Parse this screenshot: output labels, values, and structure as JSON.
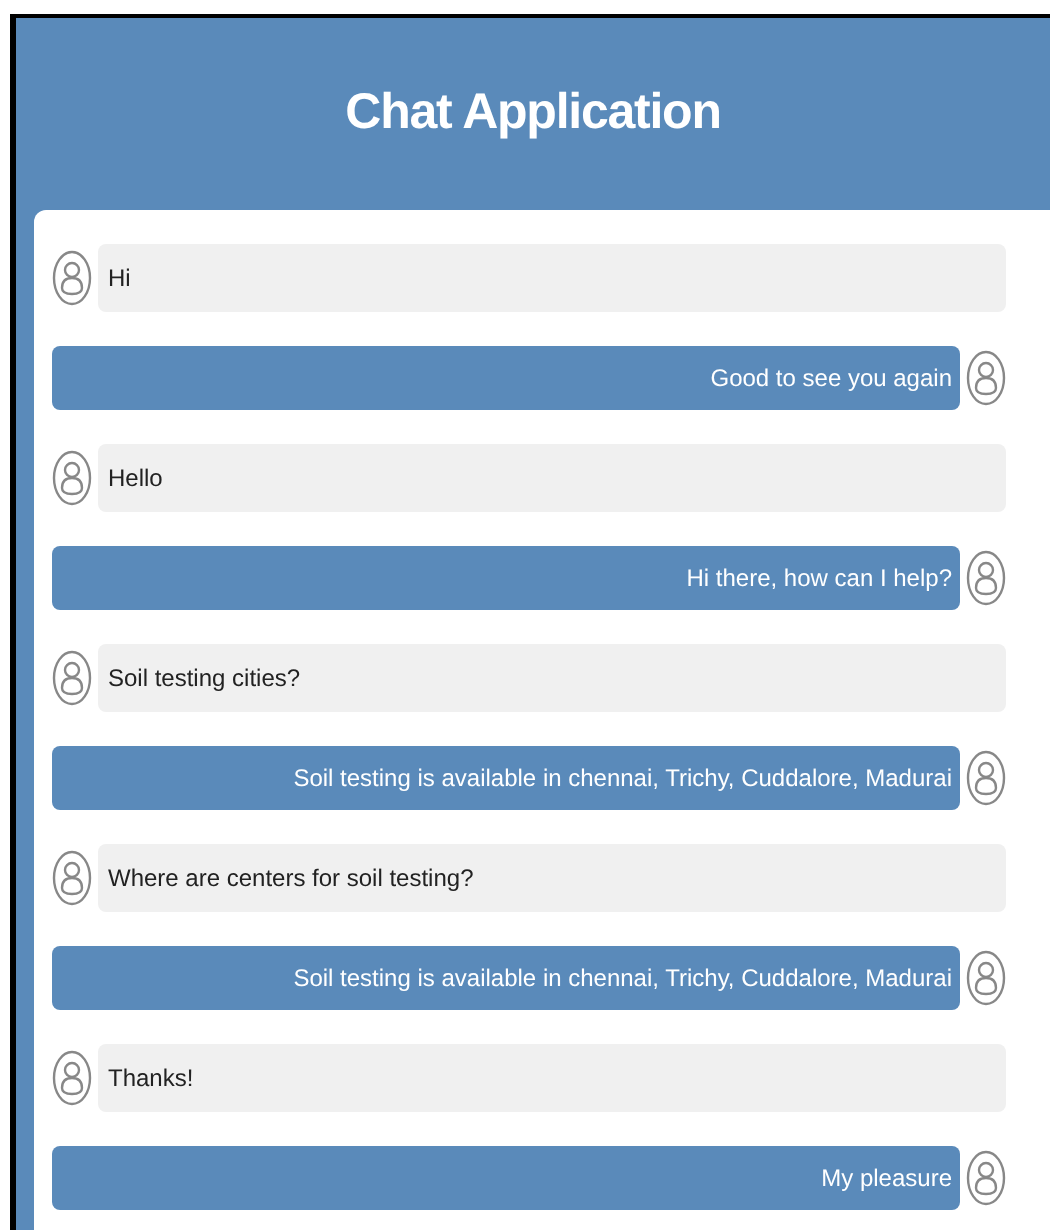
{
  "window": {
    "title": "Chat Application"
  },
  "messages": [
    {
      "kind": "user",
      "text": "Hi"
    },
    {
      "kind": "bot",
      "text": "Good to see you again"
    },
    {
      "kind": "user",
      "text": "Hello"
    },
    {
      "kind": "bot",
      "text": "Hi there, how can I help?"
    },
    {
      "kind": "user",
      "text": "Soil testing cities?"
    },
    {
      "kind": "bot",
      "text": "Soil testing is available in chennai, Trichy, Cuddalore, Madurai"
    },
    {
      "kind": "user",
      "text": "Where are centers for soil testing?"
    },
    {
      "kind": "bot",
      "text": "Soil testing is available in chennai, Trichy, Cuddalore, Madurai"
    },
    {
      "kind": "user",
      "text": "Thanks!"
    },
    {
      "kind": "bot",
      "text": "My pleasure"
    }
  ]
}
